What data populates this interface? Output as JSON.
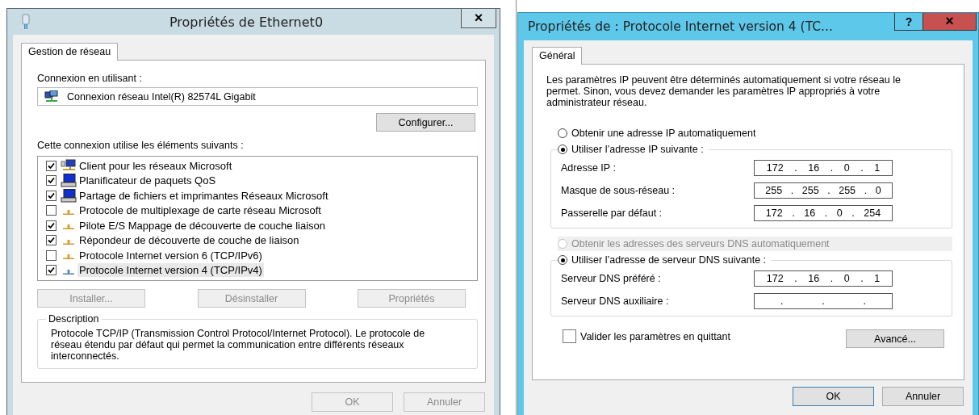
{
  "left_window": {
    "title": "Propriétés de Ethernet0",
    "close": "×",
    "tabs": [
      {
        "label": "Gestion de réseau",
        "selected": true
      }
    ],
    "connection_label": "Connexion en utilisant :",
    "adapter": "Connexion réseau Intel(R) 82574L Gigabit",
    "configure_button": "Configurer...",
    "components_label": "Cette connexion utilise les éléments suivants :",
    "components": [
      {
        "label": "Client pour les réseaux Microsoft",
        "checked": true,
        "selected": false,
        "kind": "client"
      },
      {
        "label": "Planificateur de paquets QoS",
        "checked": true,
        "selected": false,
        "kind": "service"
      },
      {
        "label": "Partage de fichiers et imprimantes Réseaux Microsoft",
        "checked": true,
        "selected": false,
        "kind": "service"
      },
      {
        "label": "Protocole de multiplexage de carte réseau Microsoft",
        "checked": false,
        "selected": false,
        "kind": "protocol"
      },
      {
        "label": "Pilote E/S Mappage de découverte de couche liaison",
        "checked": true,
        "selected": false,
        "kind": "protocol"
      },
      {
        "label": "Répondeur de découverte de couche de liaison",
        "checked": true,
        "selected": false,
        "kind": "protocol"
      },
      {
        "label": "Protocole Internet version 6 (TCP/IPv6)",
        "checked": false,
        "selected": false,
        "kind": "protocol"
      },
      {
        "label": "Protocole Internet version 4 (TCP/IPv4)",
        "checked": true,
        "selected": true,
        "kind": "protocol"
      }
    ],
    "action_buttons": [
      {
        "label": "Installer...",
        "disabled": true
      },
      {
        "label": "Désinstaller",
        "disabled": true
      },
      {
        "label": "Propriétés",
        "disabled": true
      }
    ],
    "description": {
      "title": "Description",
      "text": "Protocole TCP/IP (Transmission Control Protocol/Internet Protocol). Le protocole de réseau étendu par défaut qui permet la communication entre différents réseaux interconnectés."
    },
    "buttons": [
      {
        "label": "OK",
        "disabled": true
      },
      {
        "label": "Annuler",
        "disabled": true
      }
    ]
  },
  "right_window": {
    "title": "Propriétés de : Protocole Internet version 4 (TC...",
    "help": "?",
    "close": "×",
    "tabs": [
      {
        "label": "Général",
        "selected": true
      }
    ],
    "intro": "Les paramètres IP peuvent être déterminés automatiquement si votre réseau le permet. Sinon, vous devez demander les paramètres IP appropriés à votre administrateur réseau.",
    "ip_auto": {
      "label": "Obtenir une adresse IP automatiquement",
      "selected": false,
      "disabled": false
    },
    "ip_manual": {
      "label": "Utiliser l’adresse IP suivante :",
      "selected": true,
      "fields": [
        {
          "label": "Adresse IP :",
          "parts": [
            "172",
            ".",
            "16",
            ".",
            "0",
            ".",
            "1"
          ]
        },
        {
          "label": "Masque de sous-réseau :",
          "parts": [
            "255",
            ".",
            "255",
            ".",
            "255",
            ".",
            "0"
          ]
        },
        {
          "label": "Passerelle par défaut :",
          "parts": [
            "172",
            ".",
            "16",
            ".",
            "0",
            ".",
            "254"
          ]
        }
      ]
    },
    "dns_auto": {
      "label": "Obtenir les adresses des serveurs DNS automatiquement",
      "selected": false,
      "disabled": true
    },
    "dns_manual": {
      "label": "Utiliser l’adresse de serveur DNS suivante :",
      "selected": true,
      "fields": [
        {
          "label": "Serveur DNS préféré :",
          "parts": [
            "172",
            ".",
            "16",
            ".",
            "0",
            ".",
            "1"
          ]
        },
        {
          "label": "Serveur DNS auxiliaire :",
          "parts": [
            ".",
            ".",
            "."
          ]
        }
      ]
    },
    "validate": {
      "label": "Valider les paramètres en quittant",
      "checked": false
    },
    "advanced_button": "Avancé...",
    "buttons": [
      {
        "label": "OK",
        "default": true
      },
      {
        "label": "Annuler",
        "default": false
      }
    ]
  }
}
